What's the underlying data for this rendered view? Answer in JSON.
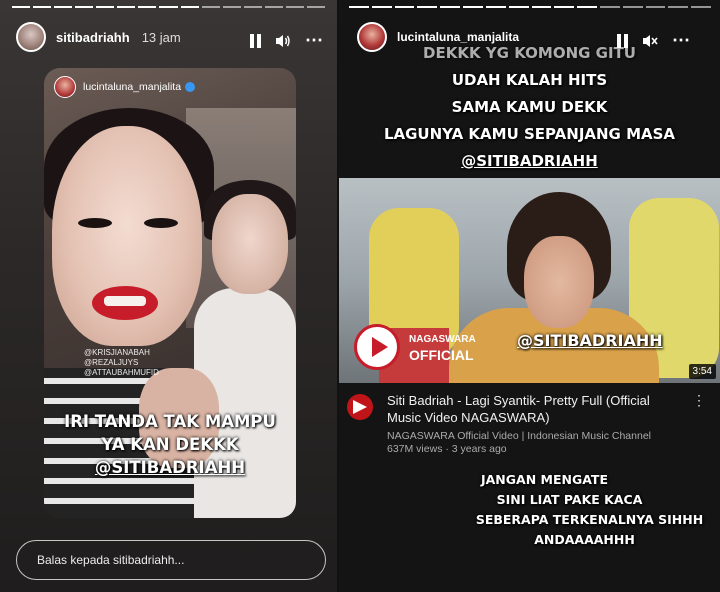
{
  "left_story": {
    "username": "sitibadriahh",
    "time": "13 jam",
    "repost": {
      "username": "lucintaluna_manjalita",
      "tags": [
        "@KRISJIANABAH",
        "@REZALJUYS",
        "@ATTAUBAHMUFID"
      ],
      "caption_lines": [
        "IRI TANDA TAK MAMPU",
        "YA KAN DEKKK"
      ],
      "caption_mention": "@SITIBADRIAHH"
    },
    "reply_placeholder": "Balas kepada sitibadriahh..."
  },
  "right_story": {
    "username": "lucintaluna_manjalita",
    "top_text": [
      "DEKKK YG KOMONG GITU",
      "UDAH KALAH HITS",
      "SAMA KAMU DEKK",
      "LAGUNYA KAMU SEPANJANG MASA",
      "@SITIBADRIAHH"
    ],
    "video": {
      "thumb_mention": "@SITIBADRIAHH",
      "logo_small": "NAGASWARA",
      "logo_big": "OFFICIAL",
      "duration": "3:54",
      "title": "Siti Badriah - Lagi Syantik- Pretty Full (Official Music Video NAGASWARA)",
      "channel": "NAGASWARA Official Video | Indonesian Music Channel",
      "views": "637M views · 3 years ago"
    },
    "bottom_text": [
      "JANGAN MENGATE",
      "SINI LIAT PAKE KACA",
      "SEBERAPA TERKENALNYA SIHHH",
      "ANDAAAAHHH"
    ]
  },
  "colors": {
    "youtube_red": "#c01518",
    "verified_blue": "#3897f0"
  }
}
